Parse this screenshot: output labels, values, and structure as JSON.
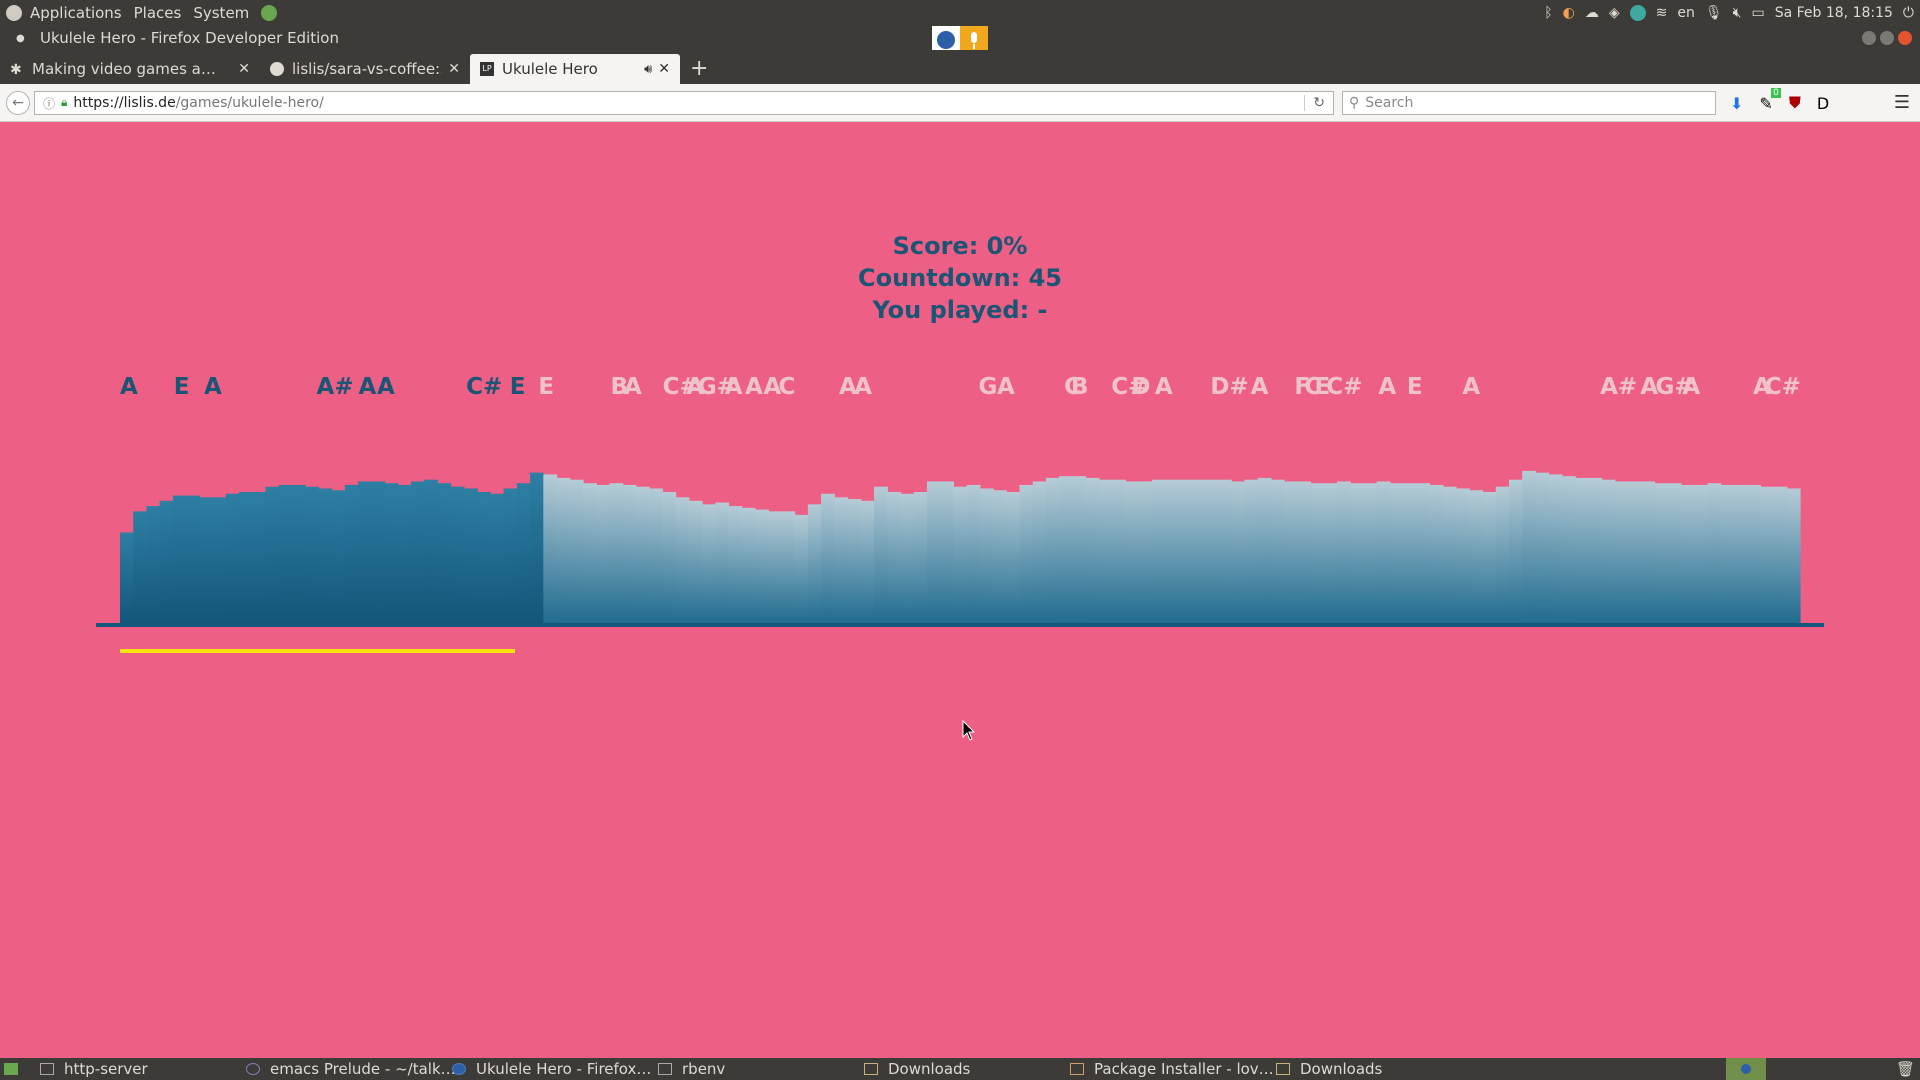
{
  "top_panel": {
    "menus": [
      "Applications",
      "Places",
      "System"
    ],
    "keyboard_layout": "en",
    "datetime": "Sa Feb 18, 18:15"
  },
  "window": {
    "title": "Ukulele Hero - Firefox Developer Edition"
  },
  "tabs": [
    {
      "label": "Making video games a…",
      "active": false
    },
    {
      "label": "lislis/sara-vs-coffee:…",
      "active": false
    },
    {
      "label": "Ukulele Hero",
      "active": true,
      "favicon_text": "LP"
    }
  ],
  "nav": {
    "url": "https://lislis.de/games/ukulele-hero/",
    "url_host": "https://lislis.de",
    "url_path": "/games/ukulele-hero/",
    "search_placeholder": "Search",
    "addon_badge": "0"
  },
  "game": {
    "score_text": "Score: 0%",
    "countdown_text": "Countdown: 45",
    "played_text": "You played: -",
    "progress": 0.235,
    "notes_played": [
      {
        "label": "A",
        "pos": 0.0
      },
      {
        "label": "E",
        "pos": 0.032
      },
      {
        "label": "A",
        "pos": 0.05
      },
      {
        "label": "A#",
        "pos": 0.117
      },
      {
        "label": "A",
        "pos": 0.142
      },
      {
        "label": "A",
        "pos": 0.153
      },
      {
        "label": "C#",
        "pos": 0.206
      },
      {
        "label": "E",
        "pos": 0.232
      }
    ],
    "notes_upcoming": [
      {
        "label": "E",
        "pos": 0.249
      },
      {
        "label": "B",
        "pos": 0.292
      },
      {
        "label": "A",
        "pos": 0.3
      },
      {
        "label": "C#",
        "pos": 0.323
      },
      {
        "label": "A",
        "pos": 0.337
      },
      {
        "label": "G#",
        "pos": 0.344
      },
      {
        "label": "A",
        "pos": 0.36
      },
      {
        "label": "A",
        "pos": 0.372
      },
      {
        "label": "A",
        "pos": 0.383
      },
      {
        "label": "C",
        "pos": 0.392
      },
      {
        "label": "A",
        "pos": 0.428
      },
      {
        "label": "A",
        "pos": 0.437
      },
      {
        "label": "G",
        "pos": 0.511
      },
      {
        "label": "A",
        "pos": 0.522
      },
      {
        "label": "C",
        "pos": 0.562
      },
      {
        "label": "B",
        "pos": 0.566
      },
      {
        "label": "C#",
        "pos": 0.59
      },
      {
        "label": "D",
        "pos": 0.602
      },
      {
        "label": "A",
        "pos": 0.616
      },
      {
        "label": "D#",
        "pos": 0.649
      },
      {
        "label": "A",
        "pos": 0.673
      },
      {
        "label": "F",
        "pos": 0.699
      },
      {
        "label": "C",
        "pos": 0.705
      },
      {
        "label": "E",
        "pos": 0.711
      },
      {
        "label": "C#",
        "pos": 0.718
      },
      {
        "label": "A",
        "pos": 0.749
      },
      {
        "label": "E",
        "pos": 0.766
      },
      {
        "label": "A",
        "pos": 0.799
      },
      {
        "label": "A#",
        "pos": 0.881
      },
      {
        "label": "A",
        "pos": 0.905
      },
      {
        "label": "G#",
        "pos": 0.914
      },
      {
        "label": "A",
        "pos": 0.93
      },
      {
        "label": "A",
        "pos": 0.972
      },
      {
        "label": "C#",
        "pos": 0.979
      }
    ],
    "waveform": [
      0.52,
      0.64,
      0.67,
      0.7,
      0.73,
      0.73,
      0.72,
      0.72,
      0.74,
      0.75,
      0.75,
      0.78,
      0.79,
      0.79,
      0.78,
      0.77,
      0.76,
      0.79,
      0.81,
      0.81,
      0.8,
      0.79,
      0.81,
      0.82,
      0.8,
      0.78,
      0.77,
      0.75,
      0.74,
      0.77,
      0.8,
      0.86,
      0.85,
      0.83,
      0.82,
      0.8,
      0.79,
      0.8,
      0.79,
      0.78,
      0.77,
      0.75,
      0.72,
      0.7,
      0.68,
      0.69,
      0.67,
      0.66,
      0.65,
      0.64,
      0.64,
      0.62,
      0.68,
      0.74,
      0.72,
      0.71,
      0.7,
      0.78,
      0.75,
      0.74,
      0.75,
      0.81,
      0.81,
      0.78,
      0.79,
      0.77,
      0.76,
      0.75,
      0.79,
      0.81,
      0.83,
      0.84,
      0.84,
      0.83,
      0.82,
      0.82,
      0.81,
      0.81,
      0.82,
      0.82,
      0.82,
      0.82,
      0.82,
      0.82,
      0.81,
      0.82,
      0.83,
      0.82,
      0.81,
      0.81,
      0.8,
      0.8,
      0.81,
      0.8,
      0.8,
      0.81,
      0.8,
      0.8,
      0.8,
      0.79,
      0.78,
      0.77,
      0.76,
      0.75,
      0.78,
      0.82,
      0.87,
      0.86,
      0.85,
      0.84,
      0.83,
      0.83,
      0.82,
      0.81,
      0.81,
      0.81,
      0.8,
      0.8,
      0.79,
      0.79,
      0.8,
      0.79,
      0.79,
      0.79,
      0.78,
      0.78,
      0.77
    ]
  },
  "taskbar": [
    {
      "label": "http-server"
    },
    {
      "label": "emacs Prelude - ~/talk…"
    },
    {
      "label": "Ukulele Hero - Firefox…"
    },
    {
      "label": "rbenv"
    },
    {
      "label": "Downloads"
    },
    {
      "label": "Package Installer - lov…"
    },
    {
      "label": "Downloads"
    }
  ],
  "colors": {
    "page_background": "#ee5f85",
    "played_text": "#1a5575",
    "upcoming_text": "#f0c3cc",
    "progress": "#ffe10f",
    "played_wave_top": "#2e7ea3",
    "played_wave_bottom": "#12577a",
    "upcoming_wave_top": "#b6ccd6",
    "upcoming_wave_bottom": "#1f6b8f"
  }
}
